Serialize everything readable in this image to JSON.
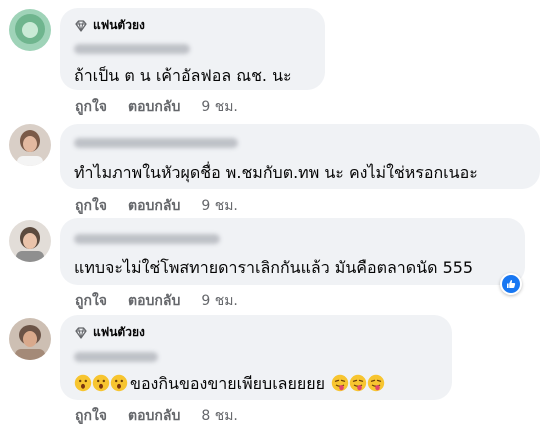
{
  "fan_badge": "แฟนตัวยง",
  "comments": [
    {
      "text": "ถ้าเป็น ต น เค้าอัลฟอล ณช. นะ",
      "like": "ถูกใจ",
      "reply": "ตอบกลับ",
      "time": "9 ชม."
    },
    {
      "text": "ทำไมภาพในหัวผุดชื่อ พ.ชมกับต.ทพ นะ คงไม่ใช่หรอกเนอะ",
      "like": "ถูกใจ",
      "reply": "ตอบกลับ",
      "time": "9 ชม."
    },
    {
      "text": "แทบจะไม่ใช่โพสทายดาราเลิกกันแล้ว มันคือตลาดนัด 555",
      "like": "ถูกใจ",
      "reply": "ตอบกลับ",
      "time": "9 ชม."
    },
    {
      "text": "ของกินของขายเพียบเลยยยย",
      "like": "ถูกใจ",
      "reply": "ตอบกลับ",
      "time": "8 ชม."
    }
  ],
  "colors": {
    "bubble": "#f0f2f5",
    "meta": "#65676b",
    "like_blue": "#1877f2"
  },
  "icons": {
    "badge": "diamond-icon",
    "reaction": "thumbs-up-icon",
    "emoji_left": "hushed-face-emoji",
    "emoji_right": "tongue-out-face-emoji"
  }
}
